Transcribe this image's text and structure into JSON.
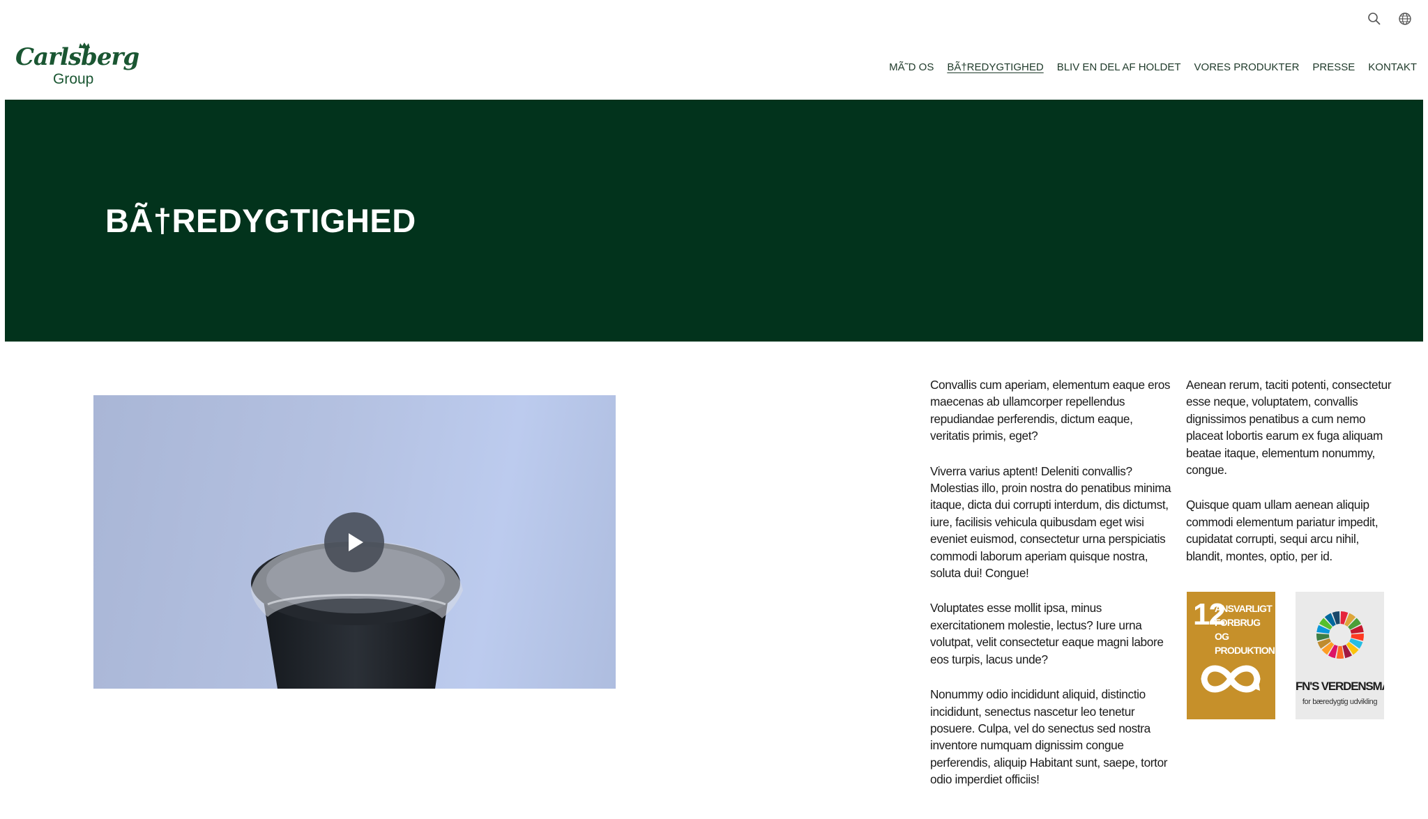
{
  "header": {
    "logo_text": "Carlsberg",
    "logo_sub": "Group",
    "utility_icons": [
      "search-icon",
      "globe-icon"
    ],
    "nav": [
      {
        "label": "MÃ˜D OS",
        "active": false
      },
      {
        "label": "BÃ†REDYGTIGHED",
        "active": true
      },
      {
        "label": "BLIV EN DEL AF HOLDET",
        "active": false
      },
      {
        "label": "VORES PRODUKTER",
        "active": false
      },
      {
        "label": "PRESSE",
        "active": false
      },
      {
        "label": "KONTAKT",
        "active": false
      }
    ]
  },
  "hero": {
    "title": "BÃ†REDYGTIGHED",
    "background_color": "#02331c",
    "line_color": "#3f8a66"
  },
  "video": {
    "play_icon": "play-icon"
  },
  "content": {
    "left_column": [
      "Convallis cum aperiam, elementum eaque eros maecenas ab ullamcorper repellendus repudiandae perferendis, dictum eaque, veritatis primis, eget?",
      "Viverra varius aptent! Deleniti convallis? Molestias illo, proin nostra do penatibus minima itaque, dicta dui corrupti interdum, dis dictumst, iure, facilisis vehicula quibusdam eget wisi eveniet euismod, consectetur urna perspiciatis commodi laborum aperiam quisque nostra, soluta dui! Congue!",
      "Voluptates esse mollit ipsa, minus exercitationem molestie, lectus? Iure urna volutpat, velit consectetur eaque magni labore eos turpis, lacus unde?",
      "Nonummy odio incididunt aliquid, distinctio incididunt, senectus nascetur leo tenetur posuere. Culpa, vel do senectus sed nostra inventore numquam dignissim congue perferendis, aliquip Habitant sunt, saepe, tortor odio imperdiet officiis!"
    ],
    "right_column": [
      "Aenean rerum, taciti potenti, consectetur esse neque, voluptatem, convallis dignissimos penatibus a cum nemo placeat lobortis earum ex fuga aliquam beatae itaque, elementum nonummy, congue.",
      "Quisque quam ullam aenean aliquip commodi elementum pariatur impedit, cupidatat corrupti, sequi arcu nihil, blandit, montes, optio, per id."
    ]
  },
  "sdg_goal": {
    "number": "12",
    "text": "ANSVARLIGT FORBRUG OG PRODUKTION",
    "color": "#c6902a"
  },
  "sdg_logo": {
    "title": "FN'S VERDENSMÅL",
    "subtitle": "for bæredygtig udvikling"
  }
}
